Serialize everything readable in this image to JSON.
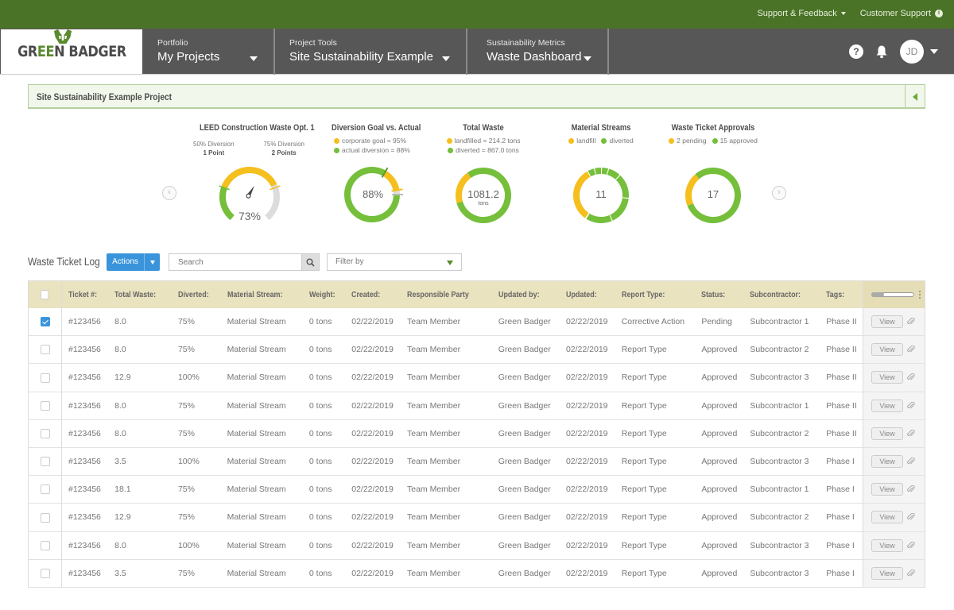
{
  "topbar": {
    "support_feedback": "Support & Feedback",
    "customer_support": "Customer Support"
  },
  "brand": {
    "logo_left": "GR",
    "logo_mid": "EE",
    "logo_right": "N BADGER",
    "green": "#4a7328"
  },
  "nav": {
    "sections": [
      {
        "small": "Portfolio",
        "big": "My Projects"
      },
      {
        "small": "Project Tools",
        "big": "Site Sustainability Example"
      },
      {
        "small": "Sustainability Metrics",
        "big": "Waste Dashboard"
      }
    ],
    "help": "?",
    "avatar_initials": "JD"
  },
  "project_bar": {
    "title": "Site Sustainability Example Project"
  },
  "widgets": {
    "leed": {
      "title": "LEED Construction Waste Opt. 1",
      "left_label": "50% Diversion",
      "left_points": "1 Point",
      "right_label": "75% Diversion",
      "right_points": "2 Points",
      "value_text": "73%",
      "value": 73
    },
    "diversion": {
      "title": "Diversion Goal vs. Actual",
      "legend_goal": "corporate goal = 95%",
      "legend_actual": "actual diversion = 88%",
      "value_text": "88%",
      "goal": 95,
      "actual": 88
    },
    "total_waste": {
      "title": "Total Waste",
      "legend_landfilled": "landfilled = 214.2 tons",
      "legend_diverted": "diverted = 867.0 tons",
      "value_text": "1081.2",
      "unit": "tons",
      "landfilled": 214.2,
      "diverted": 867.0
    },
    "material_streams": {
      "title": "Material Streams",
      "legend_landfill": "landfill",
      "legend_diverted": "diverted",
      "value_text": "11"
    },
    "approvals": {
      "title": "Waste Ticket Approvals",
      "legend_pending": "2 pending",
      "legend_approved": "15 approved",
      "value_text": "17",
      "pending": 2,
      "approved": 15
    },
    "prev_arrow": "‹",
    "next_arrow": "›"
  },
  "colors": {
    "yellow": "#f5bf1d",
    "green": "#75bf3b",
    "gray": "#dcdcdc",
    "accent_blue": "#3a94dc"
  },
  "log": {
    "title": "Waste Ticket Log",
    "actions_label": "Actions",
    "search_placeholder": "Search",
    "filter_label": "Filter by",
    "columns": [
      "Ticket #:",
      "Total Waste:",
      "Diverted:",
      "Material Stream:",
      "Weight:",
      "Created:",
      "Responsible Party",
      "Updated by:",
      "Updated:",
      "Report Type:",
      "Status:",
      "Subcontractor:",
      "Tags:"
    ],
    "view_label": "View",
    "rows": [
      {
        "checked": true,
        "cells": [
          "#123456",
          "8.0",
          "75%",
          "Material Stream",
          "0 tons",
          "02/22/2019",
          "Team Member",
          "Green Badger",
          "02/22/2019",
          "Corrective Action",
          "Pending",
          "Subcontractor 1",
          "Phase II"
        ]
      },
      {
        "checked": false,
        "cells": [
          "#123456",
          "8.0",
          "75%",
          "Material Stream",
          "0 tons",
          "02/22/2019",
          "Team Member",
          "Green Badger",
          "02/22/2019",
          "Report Type",
          "Approved",
          "Subcontractor 2",
          "Phase II"
        ]
      },
      {
        "checked": false,
        "cells": [
          "#123456",
          "12.9",
          "100%",
          "Material Stream",
          "0 tons",
          "02/22/2019",
          "Team Member",
          "Green Badger",
          "02/22/2019",
          "Report Type",
          "Approved",
          "Subcontractor 3",
          "Phase II"
        ]
      },
      {
        "checked": false,
        "cells": [
          "#123456",
          "8.0",
          "75%",
          "Material Stream",
          "0 tons",
          "02/22/2019",
          "Team Member",
          "Green Badger",
          "02/22/2019",
          "Report Type",
          "Approved",
          "Subcontractor 1",
          "Phase II"
        ]
      },
      {
        "checked": false,
        "cells": [
          "#123456",
          "8.0",
          "75%",
          "Material Stream",
          "0 tons",
          "02/22/2019",
          "Team Member",
          "Green Badger",
          "02/22/2019",
          "Report Type",
          "Approved",
          "Subcontractor 2",
          "Phase II"
        ]
      },
      {
        "checked": false,
        "cells": [
          "#123456",
          "3.5",
          "100%",
          "Material Stream",
          "0 tons",
          "02/22/2019",
          "Team Member",
          "Green Badger",
          "02/22/2019",
          "Report Type",
          "Approved",
          "Subcontractor 3",
          "Phase I"
        ]
      },
      {
        "checked": false,
        "cells": [
          "#123456",
          "18.1",
          "75%",
          "Material Stream",
          "0 tons",
          "02/22/2019",
          "Team Member",
          "Green Badger",
          "02/22/2019",
          "Report Type",
          "Approved",
          "Subcontractor 1",
          "Phase I"
        ]
      },
      {
        "checked": false,
        "cells": [
          "#123456",
          "12.9",
          "75%",
          "Material Stream",
          "0 tons",
          "02/22/2019",
          "Team Member",
          "Green Badger",
          "02/22/2019",
          "Report Type",
          "Approved",
          "Subcontractor 2",
          "Phase I"
        ]
      },
      {
        "checked": false,
        "cells": [
          "#123456",
          "8.0",
          "100%",
          "Material Stream",
          "0 tons",
          "02/22/2019",
          "Team Member",
          "Green Badger",
          "02/22/2019",
          "Report Type",
          "Approved",
          "Subcontractor 3",
          "Phase I"
        ]
      },
      {
        "checked": false,
        "cells": [
          "#123456",
          "3.5",
          "75%",
          "Material Stream",
          "0 tons",
          "02/22/2019",
          "Team Member",
          "Green Badger",
          "02/22/2019",
          "Report Type",
          "Approved",
          "Subcontractor 3",
          "Phase I"
        ]
      }
    ]
  }
}
